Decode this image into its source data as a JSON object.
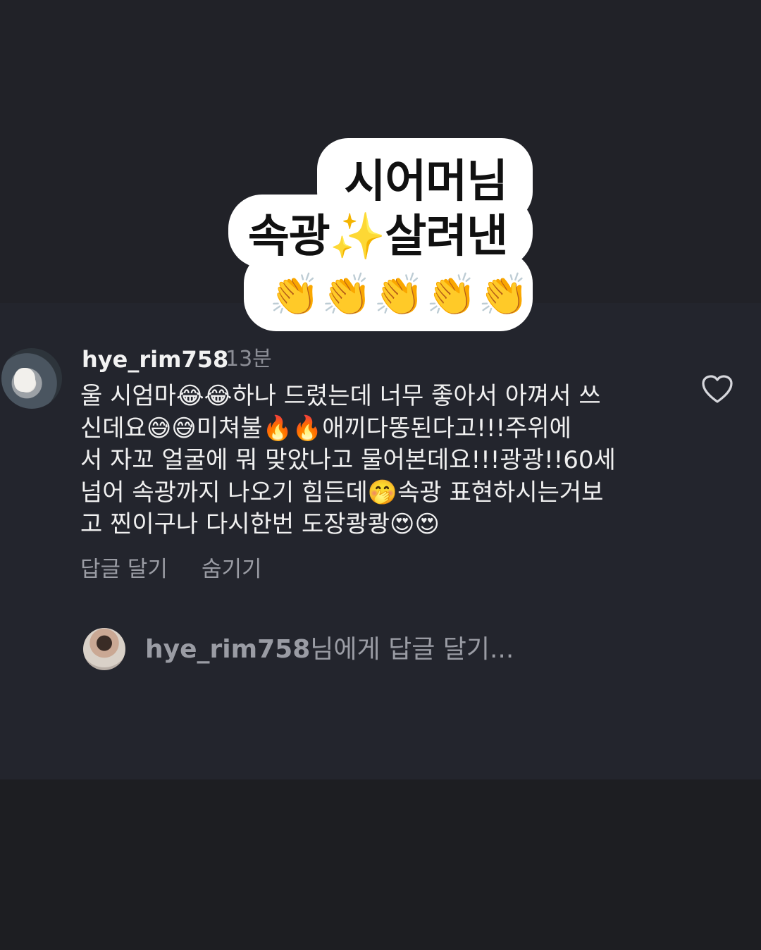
{
  "sticker": {
    "line1": "시어머님",
    "line2": "속광✨살려낸",
    "line3": "👏👏👏👏👏"
  },
  "comment": {
    "username": "hye_rim758",
    "time": "13분",
    "lines": [
      "울 시엄마😂😂하나 드렸는데 너무 좋아서 아껴서 쓰",
      "신데요😅😅미쳐불🔥🔥애끼다똥된다고!!!주위에",
      "서 자꼬 얼굴에 뭐 맞았나고 물어본데요!!!광광!!60세",
      "넘어 속광까지 나오기 힘든데🤭속광 표현하시는거보",
      "고 찐이구나 다시한번 도장쾅쾅😍😍"
    ],
    "reply_label": "답글 달기",
    "hide_label": "숨기기"
  },
  "reply_input": {
    "username": "hye_rim758",
    "suffix": "님에게 답글 달기..."
  },
  "icons": {
    "like": "heart-outline-icon"
  },
  "colors": {
    "background": "#23252d",
    "text_primary": "#f2f2f2",
    "text_secondary": "#9a9ca4"
  }
}
